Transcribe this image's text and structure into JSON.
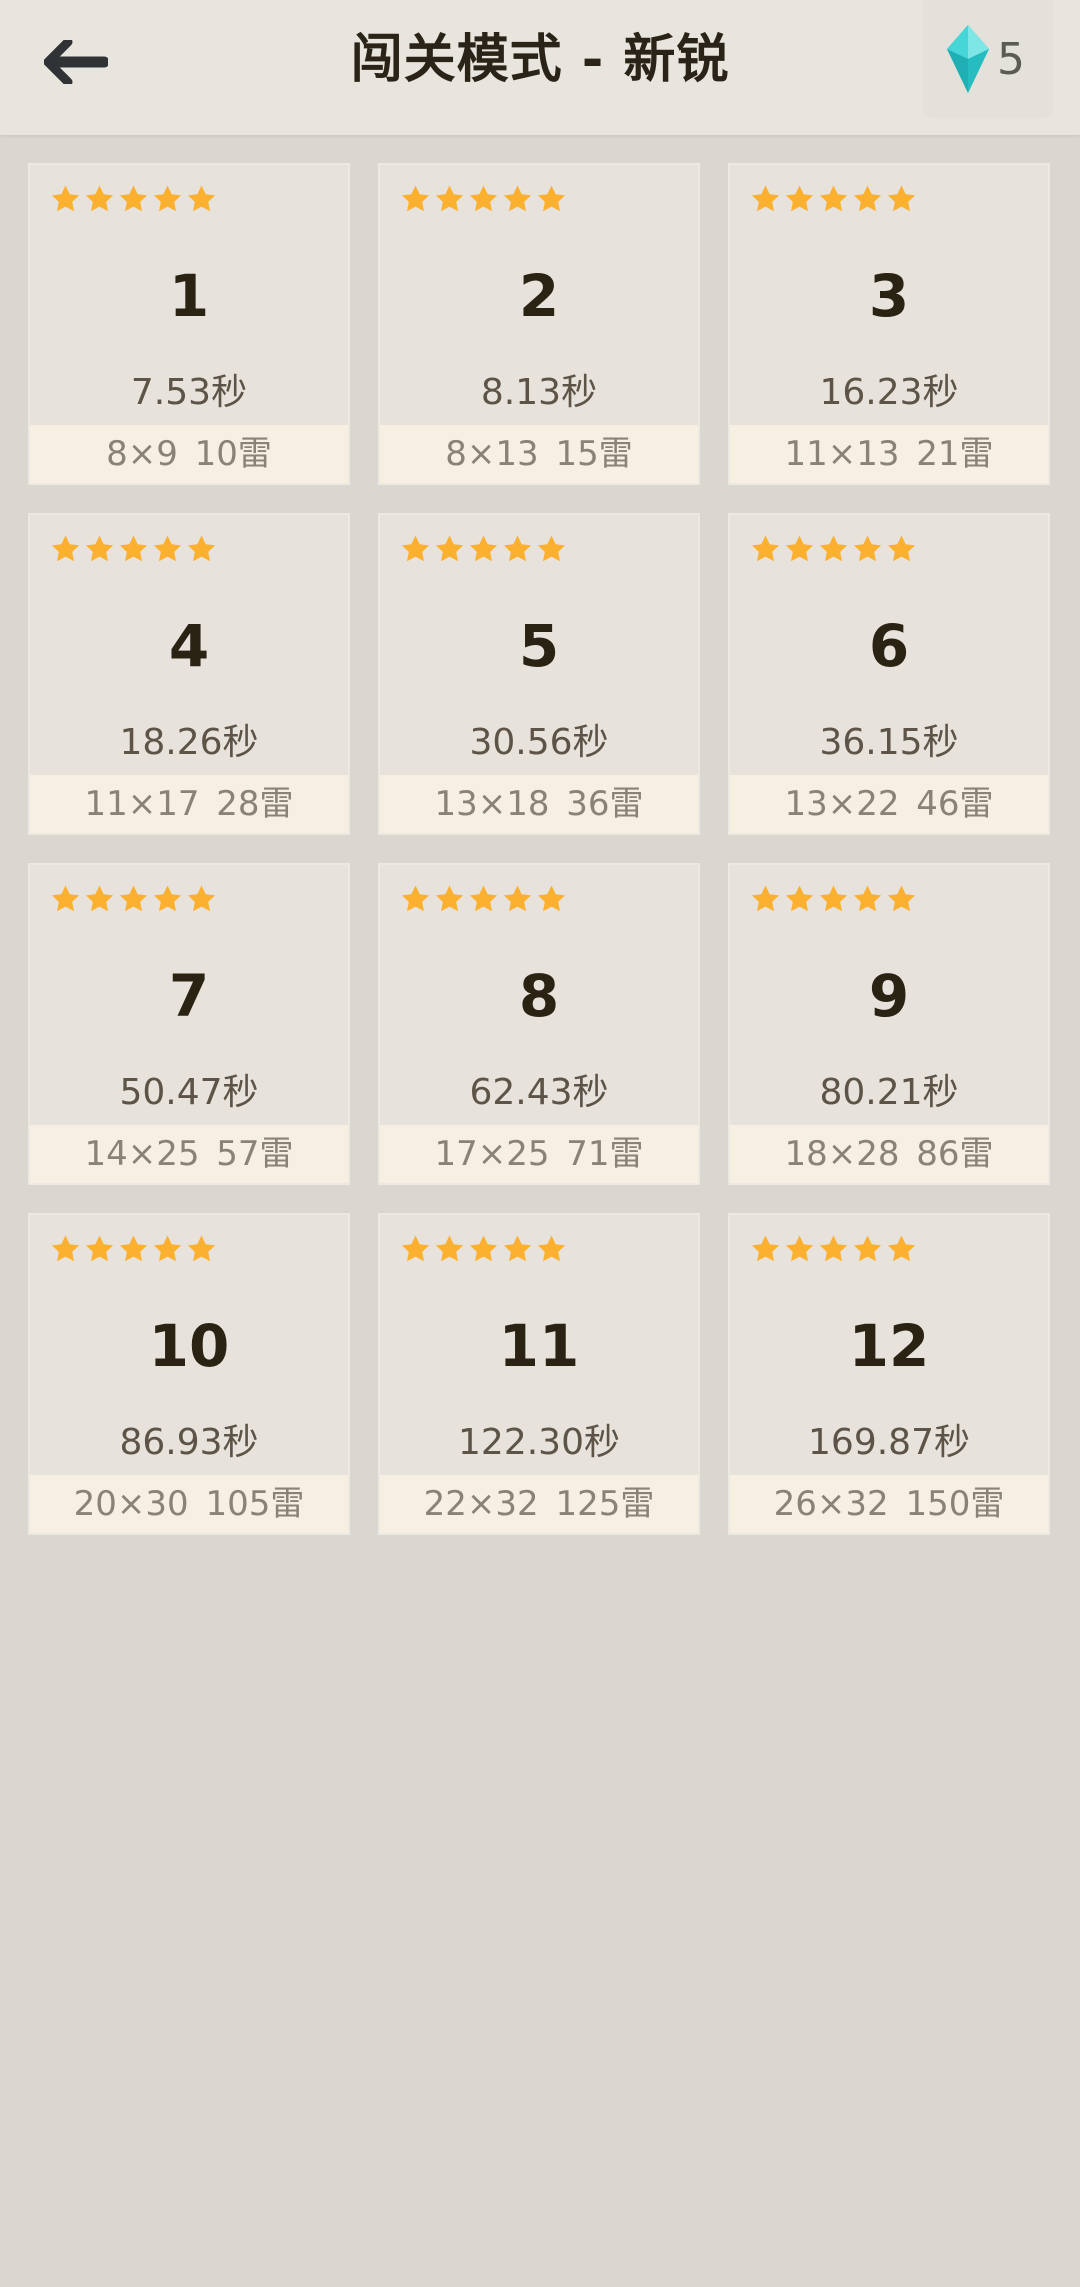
{
  "header": {
    "title": "闯关模式 - 新锐",
    "back_icon": "arrow-left-icon",
    "gem_icon": "diamond-icon",
    "gem_count": "5"
  },
  "colors": {
    "star": "#fbb02f",
    "gem": "#35cfd2",
    "background": "#dad7d0",
    "card": "#e7e3dc",
    "info_bar": "#f6efe2"
  },
  "levels": [
    {
      "number": "1",
      "time": "7.53秒",
      "info": "8×9 10雷",
      "stars": 5
    },
    {
      "number": "2",
      "time": "8.13秒",
      "info": "8×13 15雷",
      "stars": 5
    },
    {
      "number": "3",
      "time": "16.23秒",
      "info": "11×13 21雷",
      "stars": 5
    },
    {
      "number": "4",
      "time": "18.26秒",
      "info": "11×17 28雷",
      "stars": 5
    },
    {
      "number": "5",
      "time": "30.56秒",
      "info": "13×18 36雷",
      "stars": 5
    },
    {
      "number": "6",
      "time": "36.15秒",
      "info": "13×22 46雷",
      "stars": 5
    },
    {
      "number": "7",
      "time": "50.47秒",
      "info": "14×25 57雷",
      "stars": 5
    },
    {
      "number": "8",
      "time": "62.43秒",
      "info": "17×25 71雷",
      "stars": 5
    },
    {
      "number": "9",
      "time": "80.21秒",
      "info": "18×28 86雷",
      "stars": 5
    },
    {
      "number": "10",
      "time": "86.93秒",
      "info": "20×30 105雷",
      "stars": 5
    },
    {
      "number": "11",
      "time": "122.30秒",
      "info": "22×32 125雷",
      "stars": 5
    },
    {
      "number": "12",
      "time": "169.87秒",
      "info": "26×32 150雷",
      "stars": 5
    }
  ]
}
